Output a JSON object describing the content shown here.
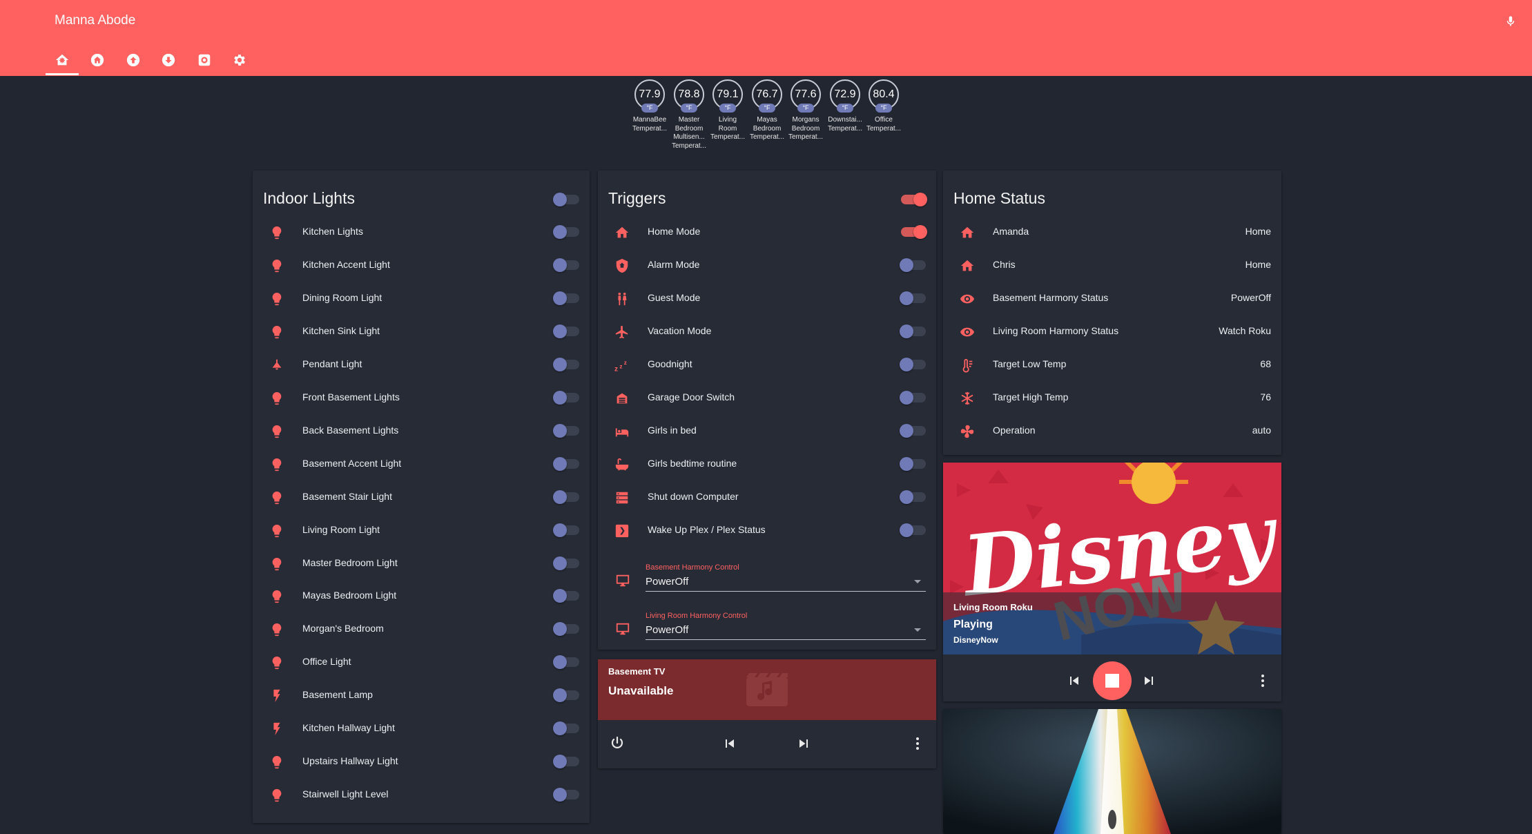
{
  "app": {
    "title": "Manna Abode",
    "accent": "#ff6161"
  },
  "tabs": [
    {
      "icon": "home-assistant-icon",
      "active": true
    },
    {
      "icon": "home-icon"
    },
    {
      "icon": "arrow-up-circle-icon"
    },
    {
      "icon": "arrow-down-circle-icon"
    },
    {
      "icon": "camera-icon"
    },
    {
      "icon": "gear-icon"
    }
  ],
  "sensors": [
    {
      "value": "77.9",
      "unit": "°F",
      "label": [
        "MannaBee",
        "Temperat..."
      ]
    },
    {
      "value": "78.8",
      "unit": "°F",
      "label": [
        "Master",
        "Bedroom",
        "Multisen...",
        "Temperat..."
      ]
    },
    {
      "value": "79.1",
      "unit": "°F",
      "label": [
        "Living",
        "Room",
        "Temperat..."
      ]
    },
    {
      "value": "76.7",
      "unit": "°F",
      "label": [
        "Mayas",
        "Bedroom",
        "Temperat..."
      ]
    },
    {
      "value": "77.6",
      "unit": "°F",
      "label": [
        "Morgans",
        "Bedroom",
        "Temperat..."
      ]
    },
    {
      "value": "72.9",
      "unit": "°F",
      "label": [
        "Downstai...",
        "Temperat..."
      ]
    },
    {
      "value": "80.4",
      "unit": "°F",
      "label": [
        "Office",
        "Temperat..."
      ]
    }
  ],
  "indoor_lights": {
    "title": "Indoor Lights",
    "master_on": false,
    "items": [
      {
        "name": "Kitchen Lights",
        "icon": "bulb-icon",
        "on": false
      },
      {
        "name": "Kitchen Accent Light",
        "icon": "bulb-icon",
        "on": false
      },
      {
        "name": "Dining Room Light",
        "icon": "bulb-icon",
        "on": false
      },
      {
        "name": "Kitchen Sink Light",
        "icon": "bulb-icon",
        "on": false
      },
      {
        "name": "Pendant Light",
        "icon": "ceiling-light-icon",
        "on": false
      },
      {
        "name": "Front Basement Lights",
        "icon": "bulb-icon",
        "on": false
      },
      {
        "name": "Back Basement Lights",
        "icon": "bulb-icon",
        "on": false
      },
      {
        "name": "Basement Accent Light",
        "icon": "bulb-icon",
        "on": false
      },
      {
        "name": "Basement Stair Light",
        "icon": "bulb-icon",
        "on": false
      },
      {
        "name": "Living Room Light",
        "icon": "bulb-icon",
        "on": false
      },
      {
        "name": "Master Bedroom Light",
        "icon": "bulb-icon",
        "on": false
      },
      {
        "name": "Mayas Bedroom Light",
        "icon": "bulb-icon",
        "on": false
      },
      {
        "name": "Morgan's Bedroom",
        "icon": "bulb-icon",
        "on": false
      },
      {
        "name": "Office Light",
        "icon": "bulb-icon",
        "on": false
      },
      {
        "name": "Basement Lamp",
        "icon": "flash-icon",
        "on": false
      },
      {
        "name": "Kitchen Hallway Light",
        "icon": "flash-icon",
        "on": false
      },
      {
        "name": "Upstairs Hallway Light",
        "icon": "bulb-icon",
        "on": false
      },
      {
        "name": "Stairwell Light Level",
        "icon": "bulb-icon",
        "on": false
      }
    ]
  },
  "triggers": {
    "title": "Triggers",
    "master_on": true,
    "items": [
      {
        "name": "Home Mode",
        "icon": "home-icon",
        "on": true
      },
      {
        "name": "Alarm Mode",
        "icon": "shield-home-icon",
        "on": false
      },
      {
        "name": "Guest Mode",
        "icon": "people-icon",
        "on": false
      },
      {
        "name": "Vacation Mode",
        "icon": "airplane-icon",
        "on": false
      },
      {
        "name": "Goodnight",
        "icon": "sleep-icon",
        "on": false
      },
      {
        "name": "Garage Door Switch",
        "icon": "garage-icon",
        "on": false
      },
      {
        "name": "Girls in bed",
        "icon": "bed-icon",
        "on": false
      },
      {
        "name": "Girls bedtime routine",
        "icon": "bathtub-icon",
        "on": false
      },
      {
        "name": "Shut down Computer",
        "icon": "server-icon",
        "on": false
      },
      {
        "name": "Wake Up Plex / Plex Status",
        "icon": "plex-icon",
        "on": false
      }
    ],
    "selects": [
      {
        "label": "Basement Harmony Control",
        "value": "PowerOff",
        "icon": "monitor-icon"
      },
      {
        "label": "Living Room Harmony Control",
        "value": "PowerOff",
        "icon": "monitor-icon"
      }
    ]
  },
  "basement_tv": {
    "title": "Basement TV",
    "state": "Unavailable"
  },
  "home_status": {
    "title": "Home Status",
    "items": [
      {
        "name": "Amanda",
        "icon": "home-icon",
        "state": "Home"
      },
      {
        "name": "Chris",
        "icon": "home-icon",
        "state": "Home"
      },
      {
        "name": "Basement Harmony Status",
        "icon": "eye-icon",
        "state": "PowerOff"
      },
      {
        "name": "Living Room Harmony Status",
        "icon": "eye-icon",
        "state": "Watch Roku"
      },
      {
        "name": "Target Low Temp",
        "icon": "thermometer-low-icon",
        "state": "68"
      },
      {
        "name": "Target High Temp",
        "icon": "snowflake-icon",
        "state": "76"
      },
      {
        "name": "Operation",
        "icon": "fan-icon",
        "state": "auto"
      }
    ]
  },
  "roku": {
    "title": "Living Room Roku",
    "state": "Playing",
    "app": "DisneyNow"
  }
}
